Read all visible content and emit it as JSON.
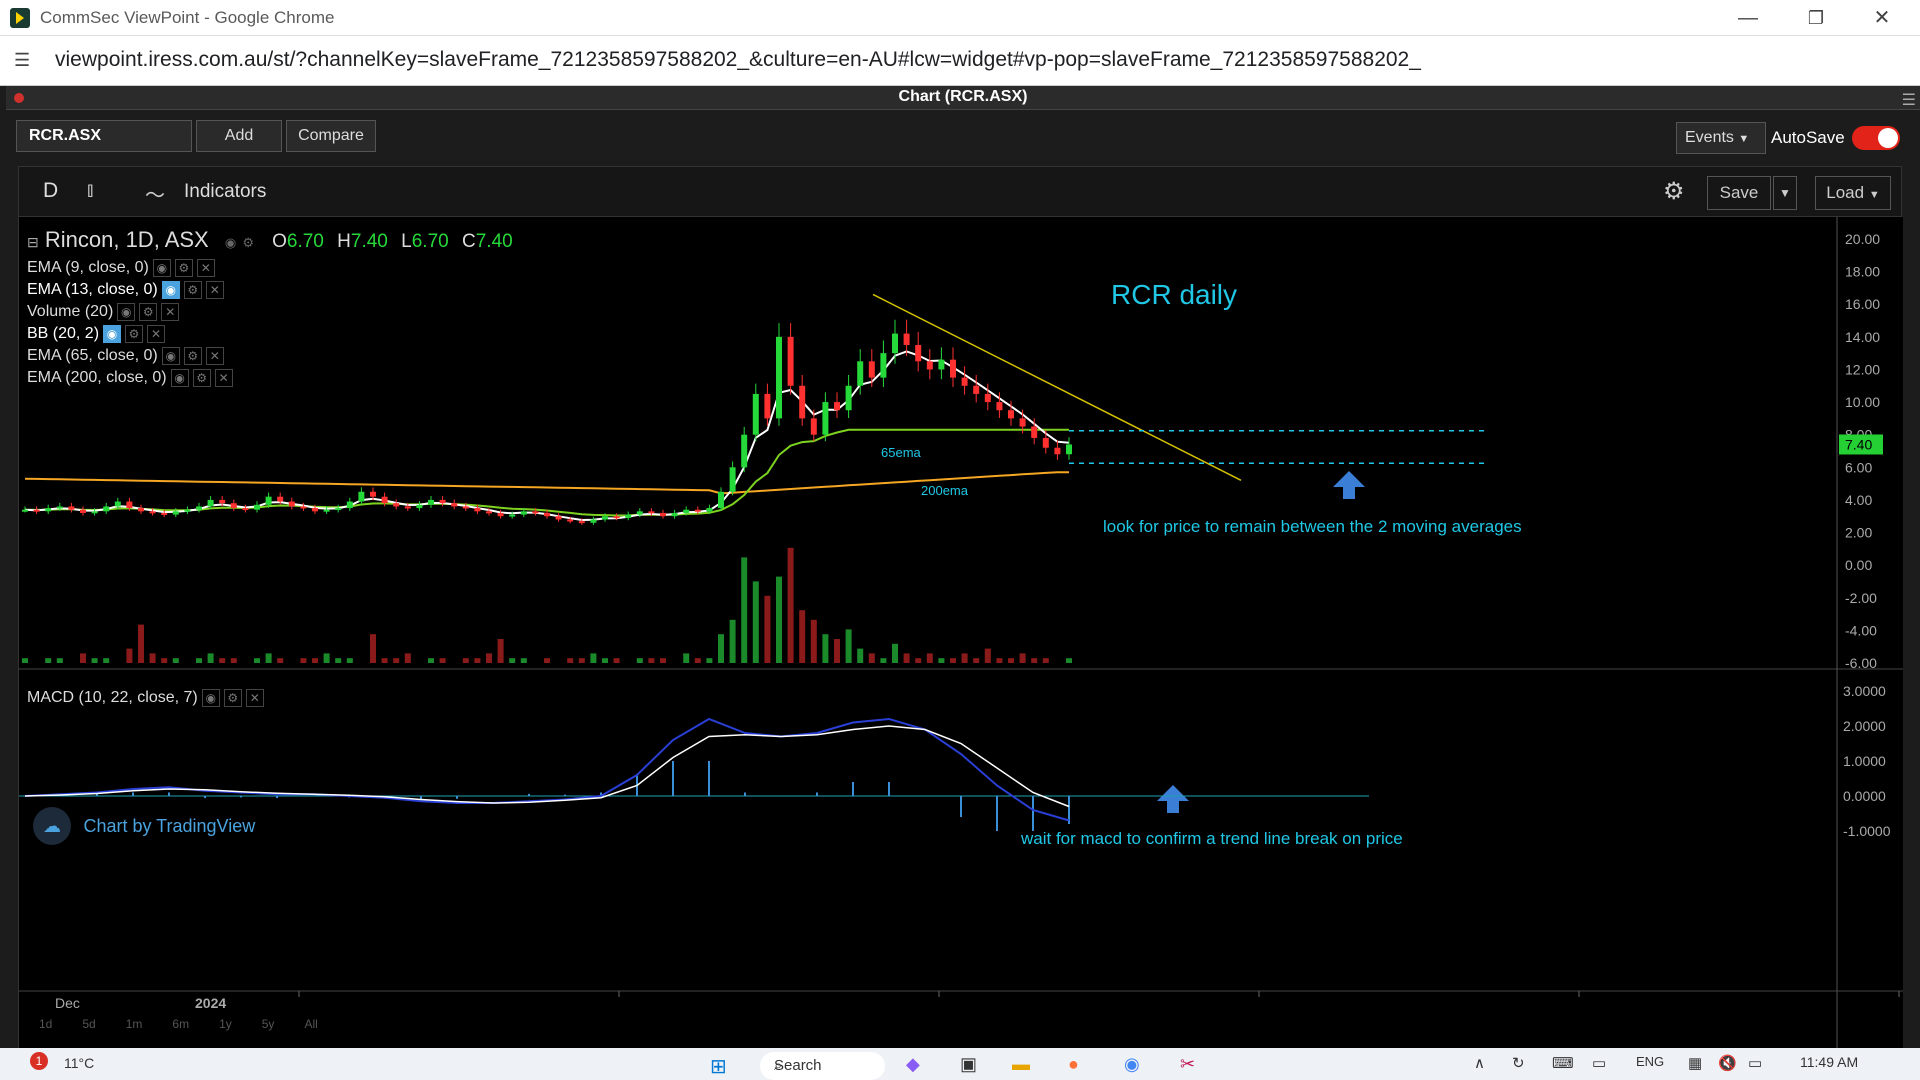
{
  "window": {
    "title": "CommSec ViewPoint - Google Chrome",
    "url": "viewpoint.iress.com.au/st/?channelKey=slaveFrame_7212358597588202_&culture=en-AU#lcw=widget#vp-pop=slaveFrame_7212358597588202_"
  },
  "app": {
    "chart_title": "Chart (RCR.ASX)",
    "symbol": "RCR.ASX",
    "add_label": "Add",
    "compare_label": "Compare",
    "events_label": "Events",
    "autosave_label": "AutoSave",
    "autosave_on": true
  },
  "tv_toolbar": {
    "interval": "D",
    "indicators_label": "Indicators",
    "save_label": "Save",
    "load_label": "Load"
  },
  "legend": {
    "series": "Rincon, 1D, ASX",
    "o_label": "O",
    "o": "6.70",
    "h_label": "H",
    "h": "7.40",
    "l_label": "L",
    "l": "6.70",
    "c_label": "C",
    "c": "7.40",
    "indicators": [
      "EMA (9, close, 0)",
      "EMA (13, close, 0)",
      "Volume (20)",
      "BB (20, 2)",
      "EMA (65, close, 0)",
      "EMA (200, close, 0)"
    ],
    "macd": "MACD (10, 22, close, 7)"
  },
  "annotations": {
    "title": "RCR daily",
    "ema65": "65ema",
    "ema200": "200ema",
    "note_price": "look for price to remain between the 2 moving averages",
    "note_macd": "wait for macd to confirm a trend line break on price"
  },
  "branding": "Chart by TradingView",
  "time_axis": [
    "Dec",
    "2024"
  ],
  "range_buttons": [
    "1d",
    "5d",
    "1m",
    "6m",
    "1y",
    "5y",
    "All"
  ],
  "taskbar": {
    "temp": "11°C",
    "search": "Search",
    "lang": "ENG",
    "time": "11:49 AM",
    "badge": "1"
  },
  "colors": {
    "up": "#26d93a",
    "down": "#ff3030",
    "ema_fast": "#ffffff",
    "ema65": "#7ed321",
    "ema200": "#f5a623",
    "trendline": "#d4c200",
    "annotation": "#20c8e6",
    "macd": "#2a3fd6",
    "signal": "#ffffff"
  },
  "chart_data": [
    {
      "type": "candlestick",
      "title": "Rincon, 1D, ASX",
      "x": [
        "Dec",
        "2024"
      ],
      "ylim": [
        -6,
        20
      ],
      "yticks": [
        "20.00",
        "18.00",
        "16.00",
        "14.00",
        "12.00",
        "10.00",
        "8.00",
        "6.00",
        "4.00",
        "2.00",
        "0.00",
        "-2.00",
        "-4.00",
        "-6.00"
      ],
      "last_price": "7.40",
      "close_series": [
        3.4,
        3.3,
        3.5,
        3.6,
        3.4,
        3.2,
        3.3,
        3.6,
        3.9,
        3.5,
        3.3,
        3.2,
        3.1,
        3.3,
        3.4,
        3.6,
        4.0,
        3.8,
        3.5,
        3.4,
        3.7,
        4.2,
        3.9,
        3.6,
        3.5,
        3.3,
        3.4,
        3.5,
        3.9,
        4.5,
        4.2,
        3.8,
        3.6,
        3.5,
        3.7,
        4.0,
        3.8,
        3.6,
        3.5,
        3.3,
        3.2,
        3.0,
        3.1,
        3.3,
        3.2,
        3.0,
        2.8,
        2.7,
        2.6,
        2.8,
        3.0,
        2.9,
        3.1,
        3.3,
        3.2,
        3.0,
        3.2,
        3.4,
        3.3,
        3.5,
        4.5,
        6.0,
        8.0,
        10.5,
        9.0,
        14.0,
        11.0,
        9.0,
        8.0,
        10.0,
        9.5,
        11.0,
        12.5,
        11.5,
        13.0,
        14.2,
        13.5,
        12.5,
        12.0,
        12.6,
        11.5,
        11.0,
        10.5,
        10.0,
        9.5,
        9.0,
        8.5,
        7.8,
        7.2,
        6.8,
        7.4
      ],
      "ema65_end": 8.0,
      "ema200_end": 5.7,
      "support_levels": [
        8.0,
        6.0
      ],
      "volume_series": [
        1,
        0,
        1,
        1,
        0,
        2,
        1,
        1,
        0,
        3,
        8,
        2,
        1,
        1,
        0,
        1,
        2,
        1,
        1,
        0,
        1,
        2,
        1,
        0,
        1,
        1,
        2,
        1,
        1,
        0,
        6,
        1,
        1,
        2,
        0,
        1,
        1,
        0,
        1,
        1,
        2,
        5,
        1,
        1,
        0,
        1,
        0,
        1,
        1,
        2,
        1,
        1,
        0,
        1,
        1,
        1,
        0,
        2,
        1,
        1,
        6,
        9,
        22,
        17,
        14,
        18,
        24,
        11,
        9,
        6,
        5,
        7,
        3,
        2,
        1,
        4,
        2,
        1,
        2,
        1,
        1,
        2,
        1,
        3,
        1,
        1,
        2,
        1,
        1,
        0,
        1
      ]
    },
    {
      "type": "line",
      "title": "MACD (10, 22, close, 7)",
      "ylim": [
        -1.5,
        3.0
      ],
      "yticks": [
        "3.0000",
        "2.0000",
        "1.0000",
        "0.0000",
        "-1.0000"
      ],
      "series": [
        {
          "name": "MACD",
          "values": [
            0,
            0.05,
            0.1,
            0.2,
            0.25,
            0.15,
            0.1,
            0.05,
            0.05,
            0.0,
            -0.05,
            -0.15,
            -0.2,
            -0.2,
            -0.15,
            -0.1,
            0.0,
            0.6,
            1.6,
            2.2,
            1.8,
            1.7,
            1.8,
            2.1,
            2.2,
            1.9,
            1.2,
            0.3,
            -0.4,
            -0.7
          ]
        },
        {
          "name": "Signal",
          "values": [
            0,
            0.03,
            0.07,
            0.15,
            0.2,
            0.18,
            0.12,
            0.08,
            0.05,
            0.02,
            -0.02,
            -0.1,
            -0.16,
            -0.2,
            -0.18,
            -0.12,
            -0.05,
            0.3,
            1.1,
            1.7,
            1.75,
            1.7,
            1.75,
            1.9,
            2.0,
            1.9,
            1.5,
            0.8,
            0.1,
            -0.3
          ]
        }
      ]
    }
  ]
}
